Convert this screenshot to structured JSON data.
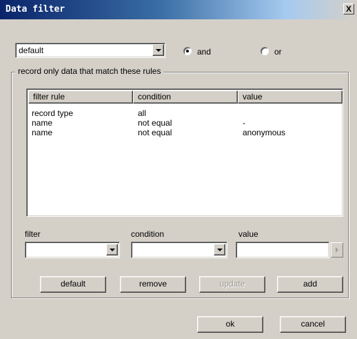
{
  "window": {
    "title": "Data filter",
    "close_glyph": "X"
  },
  "preset": {
    "value": "default"
  },
  "logic": {
    "and_label": "and",
    "or_label": "or",
    "selected": "and"
  },
  "group": {
    "label": "record only data that match these rules"
  },
  "table": {
    "columns": [
      "filter rule",
      "condition",
      "value"
    ],
    "rows": [
      [
        "record type",
        "all",
        ""
      ],
      [
        "name",
        "not equal",
        "-"
      ],
      [
        "name",
        "not equal",
        "anonymous"
      ]
    ]
  },
  "editor": {
    "filter_label": "filter",
    "condition_label": "condition",
    "value_label": "value",
    "filter_value": "",
    "condition_value": "",
    "value_value": ""
  },
  "buttons": {
    "default": "default",
    "remove": "remove",
    "update": "update",
    "add": "add",
    "ok": "ok",
    "cancel": "cancel"
  }
}
